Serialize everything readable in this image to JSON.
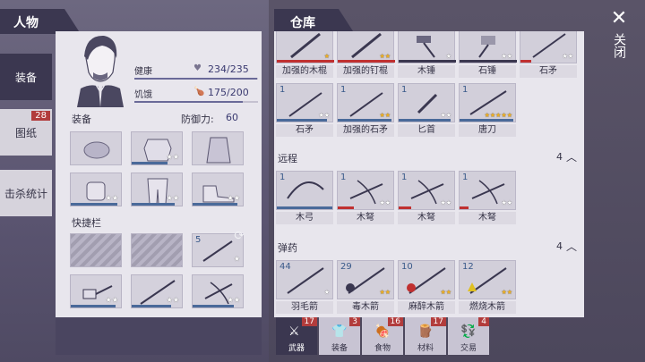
{
  "character": {
    "header": "人物",
    "tabs": [
      {
        "label": "装备",
        "badge": null
      },
      {
        "label": "图纸",
        "badge": "28"
      },
      {
        "label": "击杀统计",
        "badge": null
      }
    ],
    "health_label": "健康",
    "health_value": "234/235",
    "health_fill": 0.996,
    "hunger_label": "饥饿",
    "hunger_value": "175/200",
    "hunger_fill": 0.875,
    "equipment_title": "装备",
    "defense_label": "防御力:",
    "defense_value": "60",
    "quickbar_title": "快捷栏",
    "quickbar_count": "5"
  },
  "warehouse": {
    "header": "仓库",
    "top_items": [
      {
        "label": "加强的木棍",
        "stars": "★",
        "gold": true
      },
      {
        "label": "加强的钉棍",
        "stars": "★★",
        "gold": true
      },
      {
        "label": "木锤",
        "stars": "★",
        "gold": false
      },
      {
        "label": "石锤",
        "stars": "★★",
        "gold": false
      },
      {
        "label": "石矛",
        "stars": "★★",
        "gold": false
      }
    ],
    "row2_items": [
      {
        "count": "1",
        "label": "石矛",
        "stars": "★★",
        "gold": false
      },
      {
        "count": "1",
        "label": "加强的石矛",
        "stars": "★★",
        "gold": true
      },
      {
        "count": "1",
        "label": "匕首",
        "stars": "★★",
        "gold": false
      },
      {
        "count": "1",
        "label": "唐刀",
        "stars": "★★★★★",
        "gold": true
      }
    ],
    "ranged_title": "远程",
    "ranged_count": "4",
    "ranged_items": [
      {
        "count": "1",
        "label": "木弓",
        "stars": "",
        "gold": false
      },
      {
        "count": "1",
        "label": "木弩",
        "stars": "★★",
        "gold": false
      },
      {
        "count": "1",
        "label": "木弩",
        "stars": "★★",
        "gold": false
      },
      {
        "count": "1",
        "label": "木弩",
        "stars": "★★",
        "gold": false
      }
    ],
    "ammo_title": "弹药",
    "ammo_count": "4",
    "ammo_items": [
      {
        "count": "44",
        "label": "羽毛箭",
        "stars": "★",
        "gold": false
      },
      {
        "count": "29",
        "label": "毒木箭",
        "stars": "★★",
        "gold": true
      },
      {
        "count": "10",
        "label": "麻醉木箭",
        "stars": "★★",
        "gold": true
      },
      {
        "count": "12",
        "label": "燃烧木箭",
        "stars": "★★",
        "gold": true
      }
    ]
  },
  "bottom_tabs": [
    {
      "label": "武器",
      "badge": "17",
      "icon": "⚔"
    },
    {
      "label": "装备",
      "badge": "3",
      "icon": "👕"
    },
    {
      "label": "食物",
      "badge": "16",
      "icon": "🍖"
    },
    {
      "label": "材料",
      "badge": "17",
      "icon": "🪵"
    },
    {
      "label": "交易",
      "badge": "4",
      "icon": "💱"
    }
  ],
  "close": {
    "label": "关闭"
  }
}
